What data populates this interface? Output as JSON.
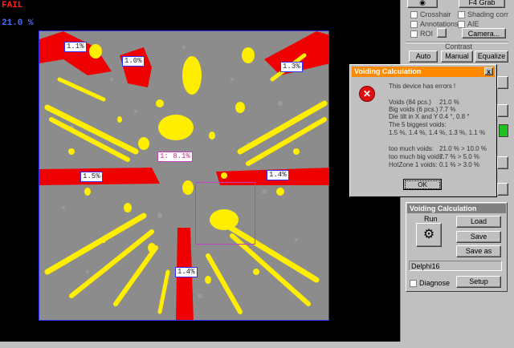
{
  "display": {
    "status": "FAIL",
    "status_color": "#ff2020",
    "voiding_total": "21.0 %",
    "roi_label": "1: 8.1%",
    "void_labels": [
      "1.1%",
      "1.0%",
      "1.3%",
      "1.5%",
      "1.4%",
      "1.4%"
    ]
  },
  "panel": {
    "top_button": "F4  Grab",
    "checkboxes": {
      "crosshair": "Crosshair",
      "shading_corr": "Shading corr",
      "annotations": "Annotations",
      "aie": "AIE",
      "roi": "ROI"
    },
    "camera_button": "Camera...",
    "contrast_label": "Contrast",
    "contrast_buttons": [
      "Auto",
      "Manual",
      "Equalize"
    ]
  },
  "dialog": {
    "title": "Voiding Calculation",
    "close_label": "x",
    "message": "This device has errors !",
    "rows": [
      {
        "label": "Voids (84 pcs.)",
        "value": "21.0 %"
      },
      {
        "label": "Big voids (6 pcs.)",
        "value": "7.7 %"
      },
      {
        "label": "Die tilt in X and Y",
        "value": "0.4 °, 0.8 °"
      }
    ],
    "biggest_title": "The 5 biggest voids:",
    "biggest_values": "1.5 %, 1.4 %, 1.4 %, 1.3 %, 1.1 %",
    "errors": [
      {
        "label": "too much voids:",
        "value": "21.0 % > 10.0 %"
      },
      {
        "label": "too much big voids:",
        "value": "7.7 % > 5.0 %"
      },
      {
        "label": "HotZone 1 voids:",
        "value": "0.1 % > 3.0 %"
      }
    ],
    "ok_label": "OK",
    "icon": "error-x-icon"
  },
  "voiding_panel": {
    "title": "Voiding Calculation",
    "run_label": "Run",
    "load_label": "Load",
    "save_label": "Save",
    "save_as_label": "Save as",
    "profile_value": "Delphi16",
    "diagnose_label": "Diagnose",
    "setup_label": "Setup"
  },
  "colors": {
    "void_yellow": "#ffee00",
    "hotzone_red": "#ee0000",
    "dialog_title": "#ff8a00"
  }
}
